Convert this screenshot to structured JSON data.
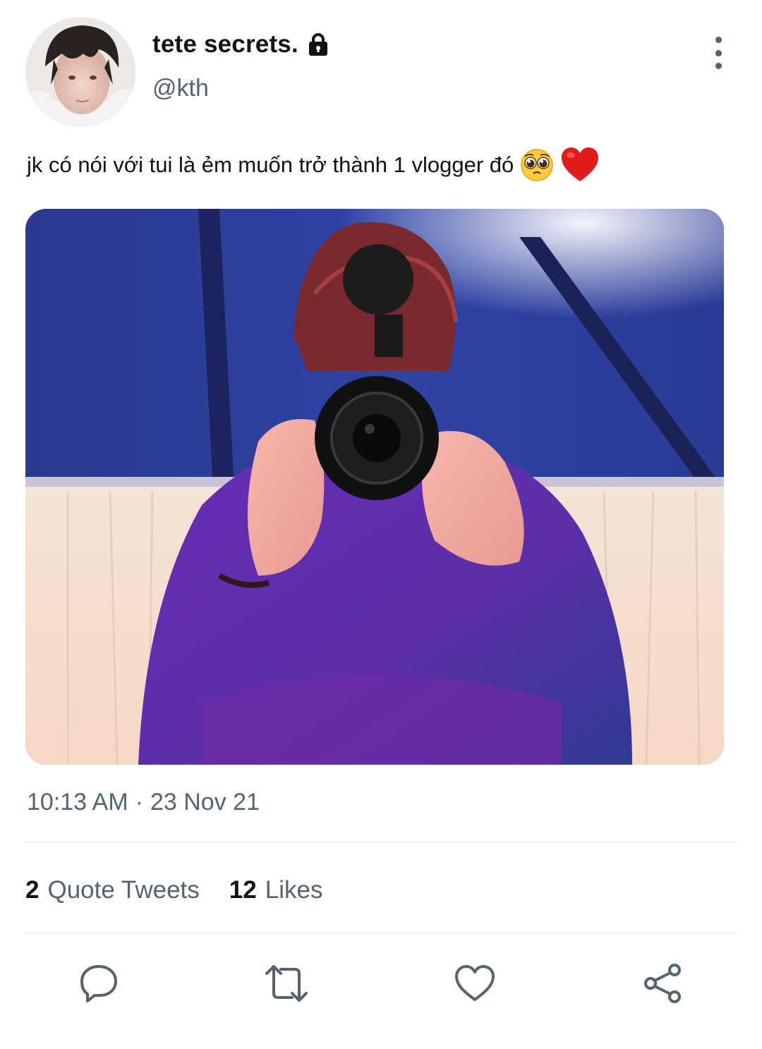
{
  "author": {
    "display_name": "tete secrets.",
    "handle": "@kth",
    "protected_icon": "lock-icon",
    "avatar_icon": "profile-photo"
  },
  "tweet": {
    "text": "jk có nói với tui là ẻm muốn trở thành 1 vlogger đó",
    "emojis": [
      "pleading-face-emoji",
      "red-heart-emoji"
    ],
    "media_icon": "photo-person-holding-camera",
    "time": "10:13 AM",
    "separator": "·",
    "date": "23 Nov 21"
  },
  "stats": {
    "quote_tweets_count": "2",
    "quote_tweets_label": "Quote Tweets",
    "likes_count": "12",
    "likes_label": "Likes"
  },
  "actions": {
    "reply_icon": "reply-icon",
    "retweet_icon": "retweet-icon",
    "like_icon": "heart-icon",
    "share_icon": "share-icon"
  },
  "colors": {
    "primary_text": "#0f1419",
    "secondary_text": "#536471",
    "divider": "#eff3f4"
  }
}
